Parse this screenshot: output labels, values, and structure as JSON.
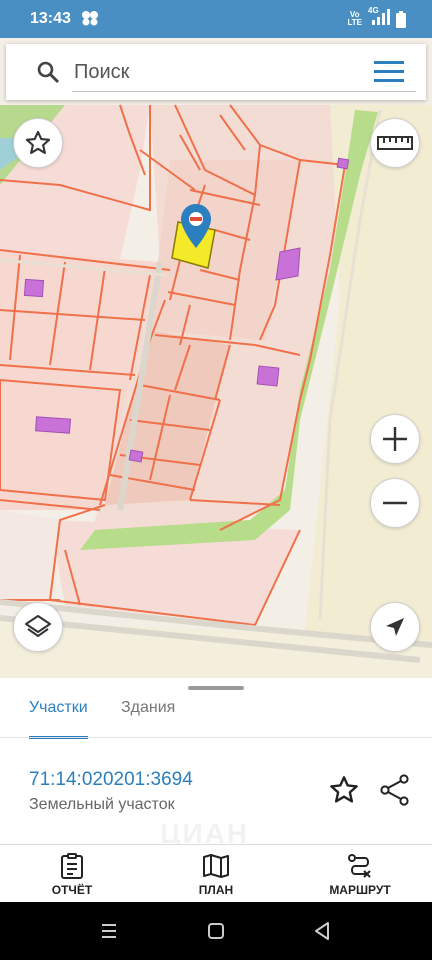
{
  "status_bar": {
    "time": "13:43",
    "network_line1": "Vo",
    "network_line2": "LTE",
    "network_type": "4G",
    "icons": [
      "app-notification-icon",
      "signal-icon",
      "battery-icon"
    ]
  },
  "search": {
    "placeholder": "Поиск",
    "icons": [
      "search-icon",
      "menu-icon"
    ]
  },
  "map": {
    "controls": [
      "favorite-star-icon",
      "ruler-icon",
      "zoom-in-icon",
      "zoom-out-icon",
      "layers-icon",
      "navigate-icon"
    ],
    "selected_marker": "location-pin-icon"
  },
  "sheet": {
    "tabs": [
      {
        "label": "Участки",
        "active": true
      },
      {
        "label": "Здания",
        "active": false
      }
    ],
    "parcel": {
      "number": "71:14:020201:3694",
      "type": "Земельный участок"
    },
    "watermark": "ЦИАН"
  },
  "bottom_nav": {
    "items": [
      {
        "label": "ОТЧЁТ",
        "icon": "report-icon"
      },
      {
        "label": "ПЛАН",
        "icon": "map-plan-icon"
      },
      {
        "label": "МАРШРУТ",
        "icon": "route-icon"
      }
    ]
  },
  "colors": {
    "accent": "#2c7fbf",
    "status_bar": "#4a8fc4",
    "parcel_border": "#f0704a",
    "building": "#c872d8",
    "selected_parcel": "#f5ea2a",
    "green_strip": "#b7dc8a"
  }
}
